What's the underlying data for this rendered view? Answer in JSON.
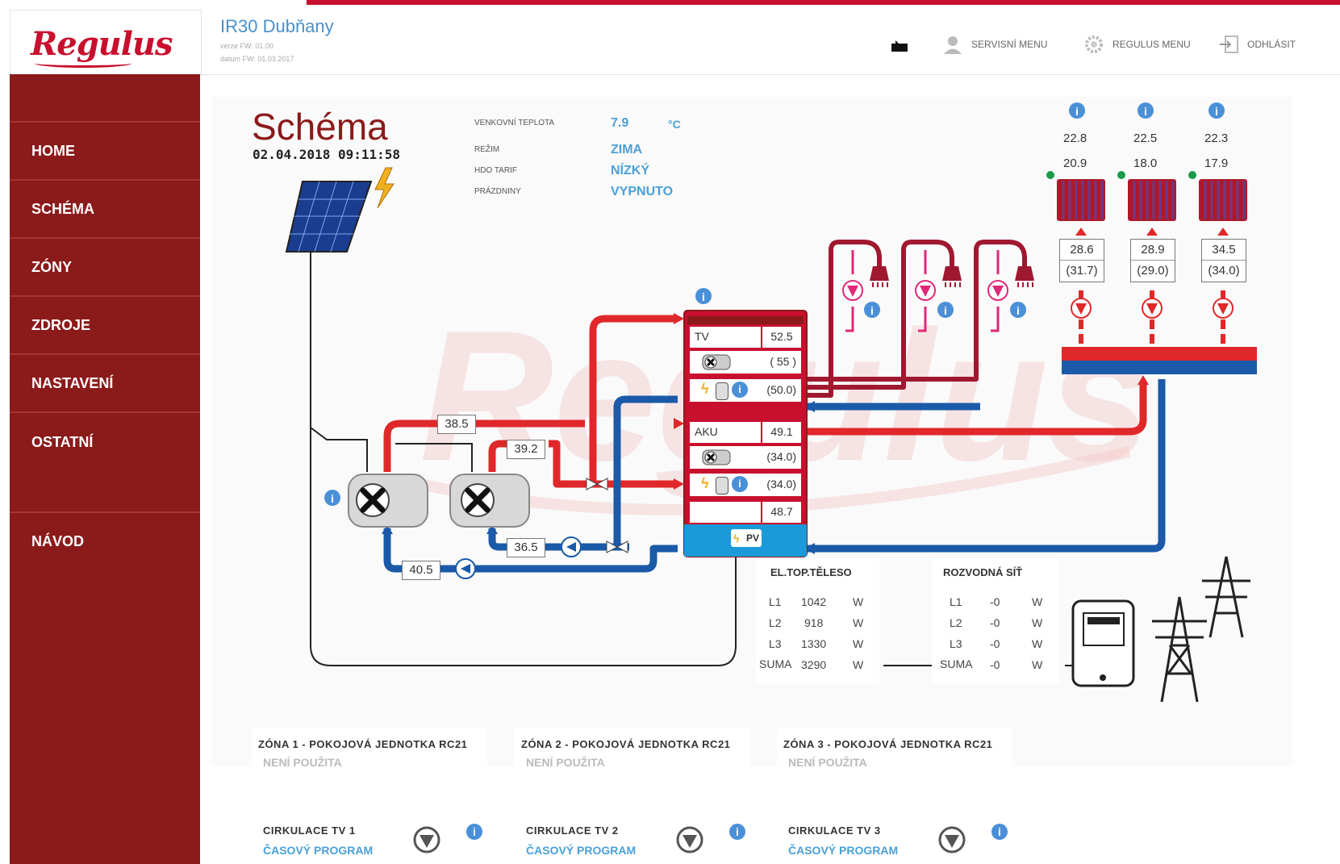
{
  "header": {
    "logo": "Regulus",
    "title": "IR30 Dubňany",
    "sub1": "verze FW: 01.00",
    "sub2": "datum FW: 01.03.2017",
    "servis": "SERVISNÍ MENU",
    "regulus_menu": "REGULUS MENU",
    "logout": "ODHLÁSIT"
  },
  "sidebar": {
    "items": [
      {
        "label": "HOME"
      },
      {
        "label": "SCHÉMA"
      },
      {
        "label": "ZÓNY"
      },
      {
        "label": "ZDROJE"
      },
      {
        "label": "NASTAVENÍ"
      },
      {
        "label": "OSTATNÍ"
      },
      {
        "label": "NÁVOD"
      }
    ]
  },
  "schema": {
    "title": "Schéma",
    "datetime": "02.04.2018 09:11:58",
    "outdoor_label": "VENKOVNÍ TEPLOTA",
    "outdoor_value": "7.9",
    "outdoor_unit": "°C",
    "mode_label": "REŽIM",
    "mode_value": "ZIMA",
    "tariff_label": "HDO TARIF",
    "tariff_value": "NÍZKÝ",
    "holiday_label": "PRÁZDNINY",
    "holiday_value": "VYPNUTO"
  },
  "heatpumps": {
    "hp_out": "38.5",
    "hp2_out": "39.2",
    "return1": "40.5",
    "return2": "36.5"
  },
  "tank": {
    "tv_label": "TV",
    "tv_value": "52.5",
    "tv_set": "( 55 )",
    "tv_el": "(50.0)",
    "aku_label": "AKU",
    "aku_value": "49.1",
    "aku_set": "(34.0)",
    "aku_el": "(34.0)",
    "bottom_value": "48.7",
    "pv_label": "PV"
  },
  "radiators": [
    {
      "room": "22.8",
      "set": "20.9",
      "flow": "28.6",
      "flow_set": "(31.7)"
    },
    {
      "room": "22.5",
      "set": "18.0",
      "flow": "28.9",
      "flow_set": "(29.0)"
    },
    {
      "room": "22.3",
      "set": "17.9",
      "flow": "34.5",
      "flow_set": "(34.0)"
    }
  ],
  "heater": {
    "title": "EL.TOP.TĚLESO",
    "rows": [
      {
        "phase": "L1",
        "value": "1042",
        "unit": "W"
      },
      {
        "phase": "L2",
        "value": "918",
        "unit": "W"
      },
      {
        "phase": "L3",
        "value": "1330",
        "unit": "W"
      },
      {
        "phase": "SUMA",
        "value": "3290",
        "unit": "W"
      }
    ]
  },
  "grid": {
    "title": "ROZVODNÁ SÍŤ",
    "rows": [
      {
        "phase": "L1",
        "value": "-0",
        "unit": "W"
      },
      {
        "phase": "L2",
        "value": "-0",
        "unit": "W"
      },
      {
        "phase": "L3",
        "value": "-0",
        "unit": "W"
      },
      {
        "phase": "SUMA",
        "value": "-0",
        "unit": "W"
      }
    ]
  },
  "zones": [
    {
      "title": "ZÓNA 1 - POKOJOVÁ JEDNOTKA RC21",
      "status": "NENÍ POUŽITA"
    },
    {
      "title": "ZÓNA 2 - POKOJOVÁ JEDNOTKA RC21",
      "status": "NENÍ POUŽITA"
    },
    {
      "title": "ZÓNA 3 - POKOJOVÁ JEDNOTKA RC21",
      "status": "NENÍ POUŽITA"
    }
  ],
  "circulations": [
    {
      "title": "CIRKULACE TV 1",
      "status": "ČASOVÝ PROGRAM"
    },
    {
      "title": "CIRKULACE TV 2",
      "status": "ČASOVÝ PROGRAM"
    },
    {
      "title": "CIRKULACE TV 3",
      "status": "ČASOVÝ PROGRAM"
    }
  ],
  "colors": {
    "brand": "#c8102e",
    "sidebar": "#8b1a1a",
    "hot_pipe": "#e0282a",
    "cold_pipe": "#1a5aa8",
    "accent_blue": "#4aa0d8"
  },
  "icons": [
    "house-icon",
    "user-icon",
    "gear-icon",
    "logout-icon",
    "info-icon",
    "pump-icon",
    "fan-icon",
    "shower-icon",
    "radiator-icon",
    "solar-panel-icon",
    "lightning-icon",
    "meter-icon",
    "pylon-icon"
  ]
}
